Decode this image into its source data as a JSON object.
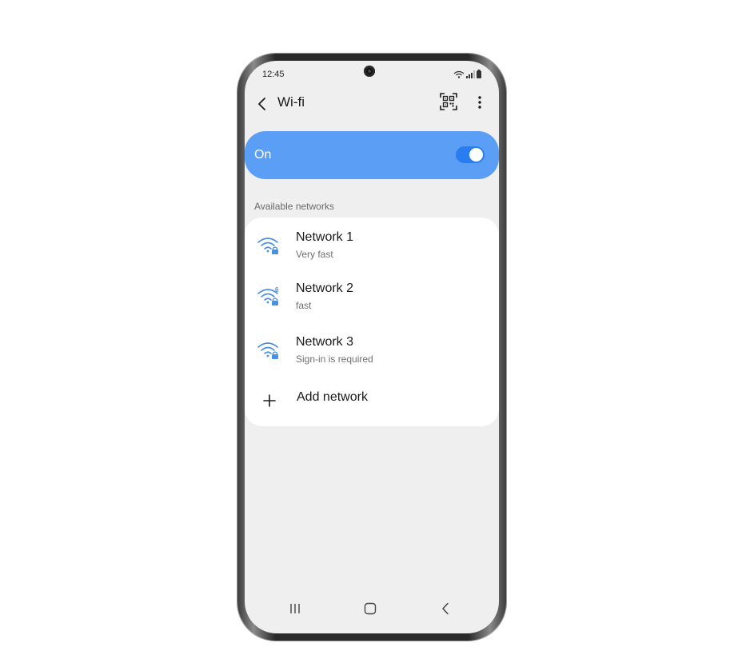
{
  "status_bar": {
    "time": "12:45"
  },
  "app_bar": {
    "title": "Wi-fi"
  },
  "master_switch": {
    "label": "On",
    "state": "on"
  },
  "networks_section": {
    "header": "Available networks",
    "items": [
      {
        "name": "Network 1",
        "status": "Very fast",
        "icon": "wifi-locked-icon"
      },
      {
        "name": "Network 2",
        "status": "fast",
        "icon": "wifi-6-locked-icon"
      },
      {
        "name": "Network 3",
        "status": "Sign-in is required",
        "icon": "wifi-locked-icon"
      }
    ],
    "add_network_label": "Add network"
  },
  "colors": {
    "accent": "#5b9ef6",
    "toggle_track": "#2a7df0",
    "wifi_icon": "#4a90e2",
    "background": "#efefef",
    "card": "#ffffff"
  }
}
